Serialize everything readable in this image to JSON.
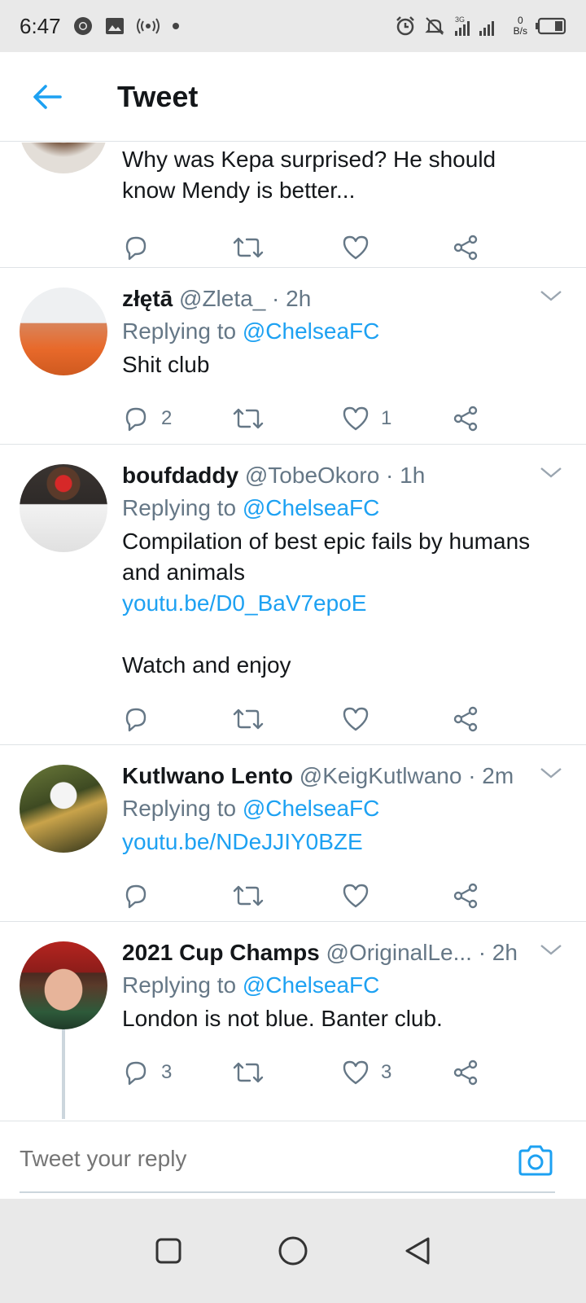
{
  "status_bar": {
    "time": "6:47",
    "network_speed_value": "0",
    "network_speed_unit": "B/s",
    "signal_label": "3G"
  },
  "header": {
    "title": "Tweet"
  },
  "tweets": [
    {
      "partial": true,
      "body": "Why was Kepa surprised? He should know Mendy is better...",
      "reply_count": "",
      "like_count": ""
    },
    {
      "name": "złętā",
      "handle": "@Zleta_ · 2h",
      "replying_label": "Replying to",
      "replying_to": "@ChelseaFC",
      "body": "Shit club",
      "reply_count": "2",
      "like_count": "1"
    },
    {
      "name": "boufdaddy",
      "handle": "@TobeOkoro · 1h",
      "replying_label": "Replying to",
      "replying_to": "@ChelseaFC",
      "body": "Compilation of best epic fails by humans and animals",
      "link": "youtu.be/D0_BaV7epoE",
      "body2": "Watch and enjoy",
      "reply_count": "",
      "like_count": ""
    },
    {
      "name": "Kutlwano Lento",
      "handle": "@KeigKutlwano · 2m",
      "replying_label": "Replying to",
      "replying_to": "@ChelseaFC",
      "link": "youtu.be/NDeJJIY0BZE",
      "reply_count": "",
      "like_count": ""
    },
    {
      "name": "2021 Cup Champs",
      "handle": "@OriginalLe... · 2h",
      "replying_label": "Replying to",
      "replying_to": "@ChelseaFC",
      "body": "London is not blue. Banter club.",
      "reply_count": "3",
      "like_count": "3"
    }
  ],
  "reply_bar": {
    "placeholder": "Tweet your reply"
  },
  "colors": {
    "accent": "#1da1f2",
    "muted": "#657786",
    "text": "#14171a"
  }
}
